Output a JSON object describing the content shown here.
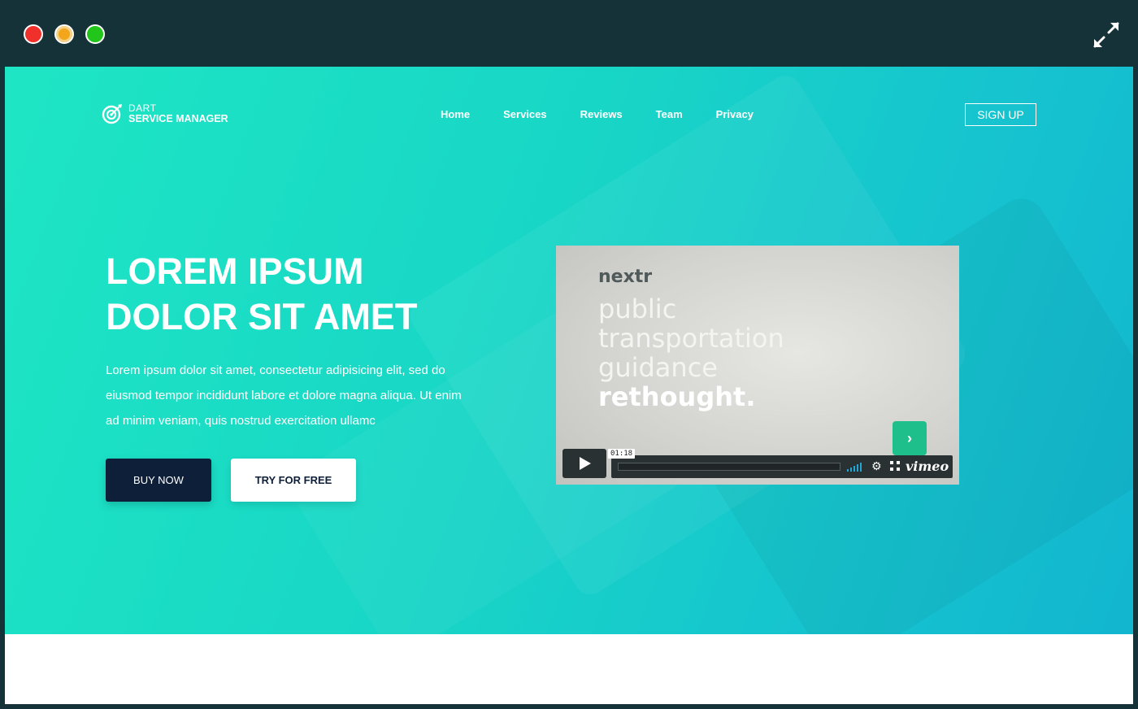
{
  "window": {
    "controls": [
      "close",
      "minimize",
      "maximize"
    ],
    "expand_icon": "expand-icon"
  },
  "header": {
    "logo": {
      "line1": "DART",
      "line2": "SERVICE MANAGER",
      "icon": "target-icon"
    },
    "nav": [
      {
        "label": "Home"
      },
      {
        "label": "Services"
      },
      {
        "label": "Reviews"
      },
      {
        "label": "Team"
      },
      {
        "label": "Privacy"
      }
    ],
    "signup_label": "SIGN UP"
  },
  "hero": {
    "headline_line1": "LOREM IPSUM",
    "headline_line2": "DOLOR SIT AMET",
    "description": "Lorem ipsum dolor sit amet, consectetur adipisicing elit, sed do eiusmod tempor incididunt labore et dolore magna aliqua. Ut enim ad minim veniam, quis nostrud exercitation ullamc",
    "buy_label": "BUY NOW",
    "try_label": "TRY FOR FREE"
  },
  "video": {
    "brand": "nextr",
    "lines": [
      "public",
      "transportation",
      "guidance",
      "rethought."
    ],
    "badge_glyph": "›",
    "time": "01:18",
    "provider": "vimeo"
  },
  "colors": {
    "hero_start": "#1ee6c4",
    "hero_end": "#12b6cf",
    "frame": "#143237",
    "buy_button": "#0e1f3a"
  }
}
